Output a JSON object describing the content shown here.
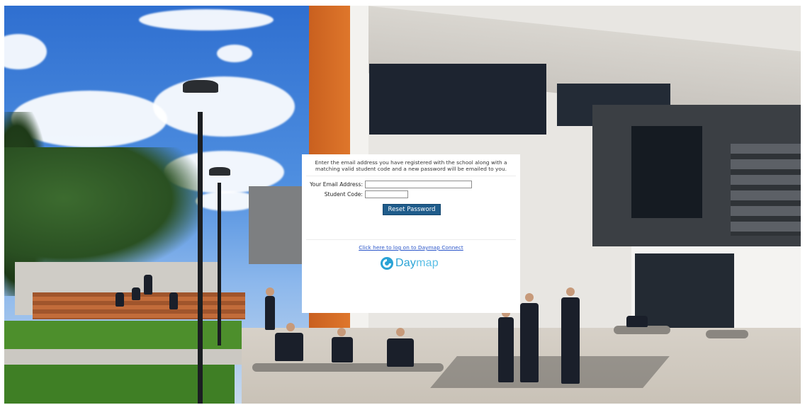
{
  "form": {
    "intro_line1": "Enter the email address you have registered with the school along with a",
    "intro_line2": "matching valid student code and a new password will be emailed to you.",
    "email_label": "Your Email Address:",
    "email_value": "",
    "student_code_label": "Student Code:",
    "student_code_value": "",
    "reset_button": "Reset Password",
    "logon_link": "Click here to log on to Daymap Connect"
  },
  "logo": {
    "text_bold": "Day",
    "text_light": "map",
    "icon": "daymap-swirl-icon",
    "color": "#2aa3d6"
  },
  "colors": {
    "button": "#1f5c8b",
    "link": "#2a55c9"
  }
}
